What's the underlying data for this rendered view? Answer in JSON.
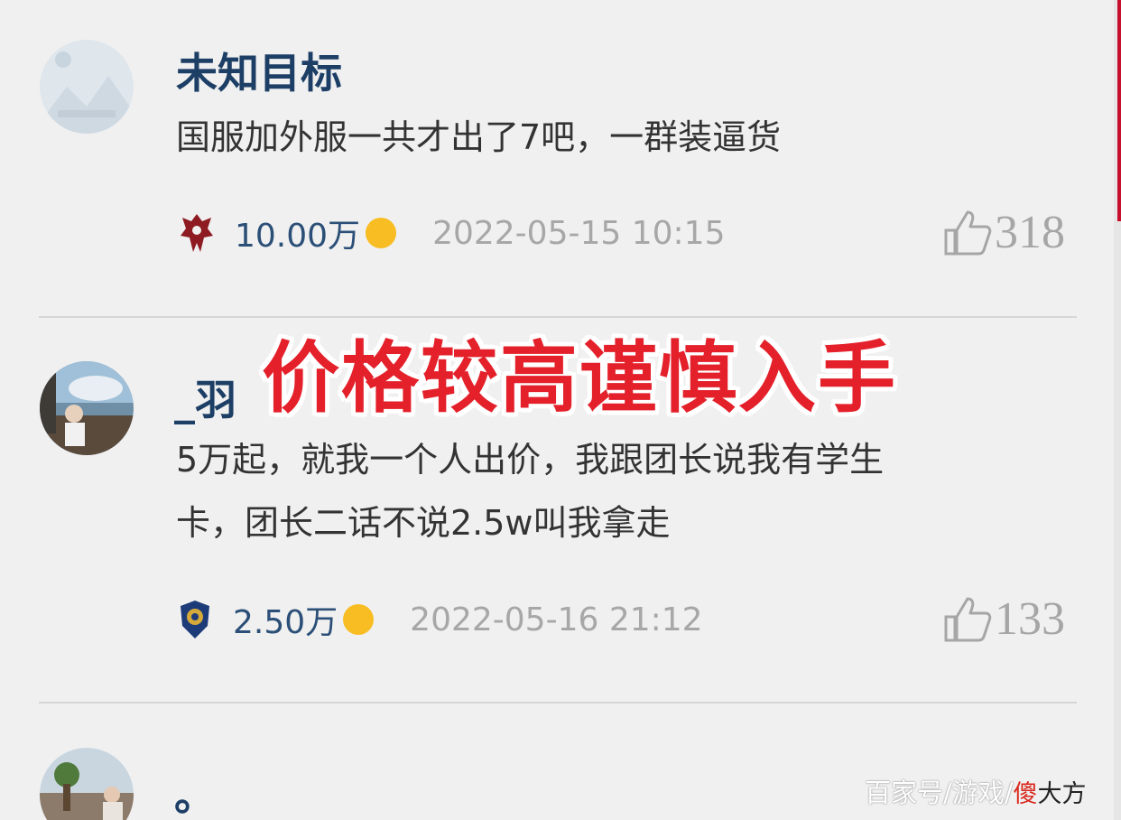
{
  "comments": [
    {
      "username": "未知目标",
      "text": "国服加外服一共才出了7吧，一群装逼货",
      "faction_icon": "horde-icon",
      "score": "10.00万",
      "timestamp": "2022-05-15 10:15",
      "likes": "318"
    },
    {
      "username": "_羽",
      "text_line1": "5万起，就我一个人出价，我跟团长说我有学生",
      "text_line2": "卡，团长二话不说2.5w叫我拿走",
      "faction_icon": "alliance-icon",
      "score": "2.50万",
      "timestamp": "2022-05-16 21:12",
      "likes": "133"
    },
    {
      "username": "。"
    }
  ],
  "overlay_title": "价格较高谨慎入手",
  "watermark": {
    "prefix": "百家号/游戏/",
    "brand_char": "傻",
    "brand_rest": "大方"
  },
  "colors": {
    "username": "#1d3f66",
    "score": "#2b4f77",
    "coin": "#f7bd22",
    "overlay": "#e4202a"
  }
}
